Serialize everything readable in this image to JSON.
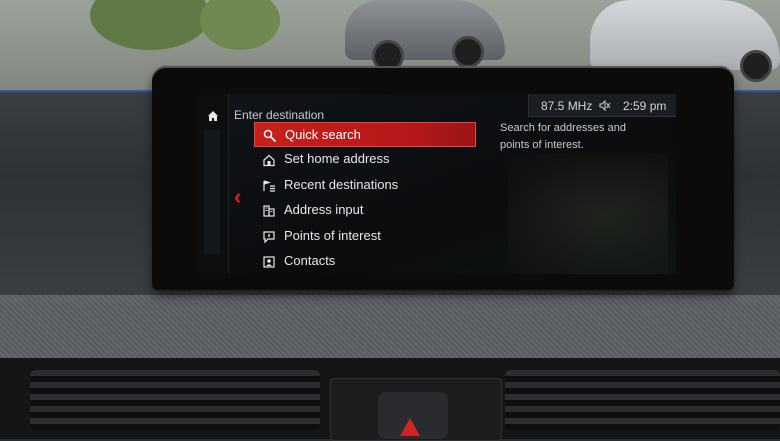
{
  "screen": {
    "header": {
      "title": "Enter destination"
    },
    "status": {
      "frequency": "87.5 MHz",
      "time": "2:59 pm"
    },
    "menu": {
      "items": [
        {
          "label": "Quick search",
          "icon": "search-icon",
          "selected": true
        },
        {
          "label": "Set home address",
          "icon": "home-address-icon",
          "selected": false
        },
        {
          "label": "Recent destinations",
          "icon": "recent-destinations-icon",
          "selected": false
        },
        {
          "label": "Address input",
          "icon": "address-input-icon",
          "selected": false
        },
        {
          "label": "Points of interest",
          "icon": "poi-icon",
          "selected": false
        },
        {
          "label": "Contacts",
          "icon": "contacts-icon",
          "selected": false
        }
      ]
    },
    "help_text": "Search for addresses and points of interest.",
    "colors": {
      "accent": "#c81f1b",
      "back_chevron": "#d8201c",
      "text": "#e6e8ea"
    }
  }
}
